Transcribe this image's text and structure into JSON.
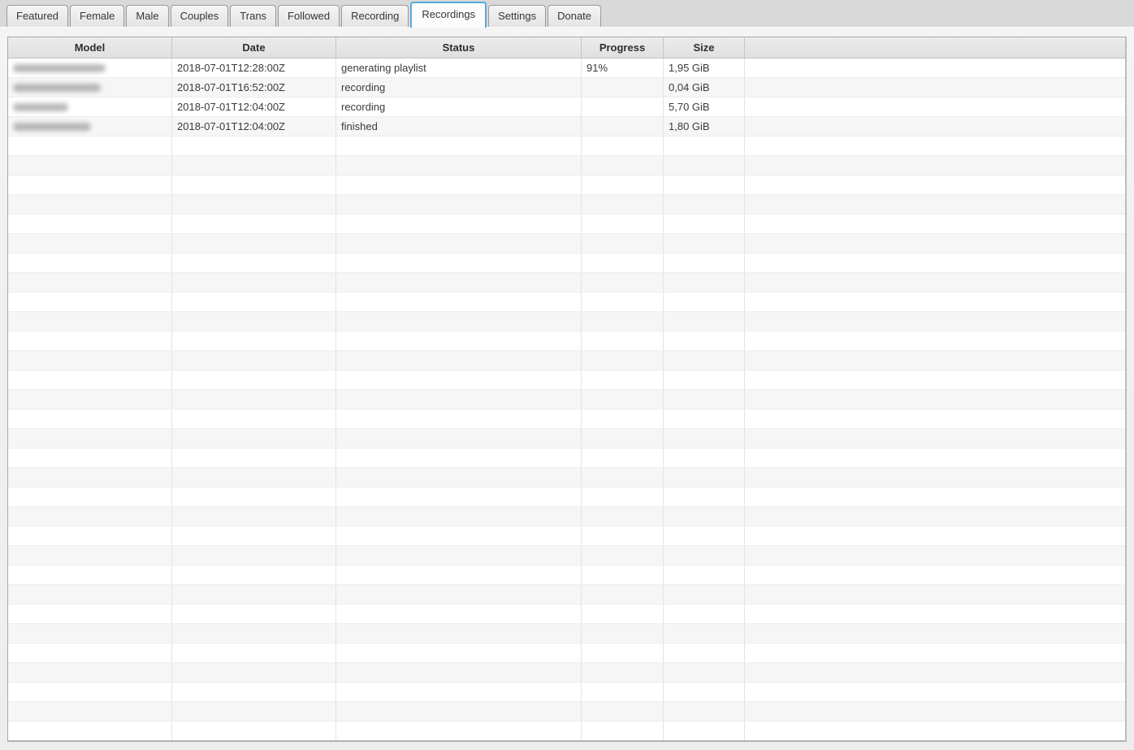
{
  "app": {
    "description": "recordings-manager-window"
  },
  "tabs": [
    {
      "label": "Featured",
      "active": false
    },
    {
      "label": "Female",
      "active": false
    },
    {
      "label": "Male",
      "active": false
    },
    {
      "label": "Couples",
      "active": false
    },
    {
      "label": "Trans",
      "active": false
    },
    {
      "label": "Followed",
      "active": false
    },
    {
      "label": "Recording",
      "active": false
    },
    {
      "label": "Recordings",
      "active": true
    },
    {
      "label": "Settings",
      "active": false
    },
    {
      "label": "Donate",
      "active": false
    }
  ],
  "table": {
    "columns": [
      {
        "key": "model",
        "label": "Model"
      },
      {
        "key": "date",
        "label": "Date"
      },
      {
        "key": "status",
        "label": "Status"
      },
      {
        "key": "progress",
        "label": "Progress"
      },
      {
        "key": "size",
        "label": "Size"
      },
      {
        "key": "fill",
        "label": ""
      }
    ],
    "rows": [
      {
        "model": "",
        "model_redacted": true,
        "model_blur_width": 114,
        "date": "2018-07-01T12:28:00Z",
        "status": "generating playlist",
        "progress": "91%",
        "size": "1,95 GiB",
        "fill": ""
      },
      {
        "model": "",
        "model_redacted": true,
        "model_blur_width": 108,
        "date": "2018-07-01T16:52:00Z",
        "status": "recording",
        "progress": "",
        "size": "0,04 GiB",
        "fill": ""
      },
      {
        "model": "",
        "model_redacted": true,
        "model_blur_width": 68,
        "date": "2018-07-01T12:04:00Z",
        "status": "recording",
        "progress": "",
        "size": "5,70 GiB",
        "fill": ""
      },
      {
        "model": "",
        "model_redacted": true,
        "model_blur_width": 96,
        "date": "2018-07-01T12:04:00Z",
        "status": "finished",
        "progress": "",
        "size": "1,80 GiB",
        "fill": ""
      }
    ],
    "empty_row_count": 31
  },
  "colors": {
    "accent_tab_border": "#58aadc",
    "tabbar_background": "#d9d9d9",
    "pane_background": "#efefef",
    "header_gradient_top": "#ececec",
    "header_gradient_bottom": "#e0e0e0",
    "row_stripe": "#f6f6f7",
    "grid_line_vertical": "#e3e3e3",
    "grid_line_horizontal": "#ededed",
    "table_border": "#a9a9a9",
    "text": "#3a3a3a"
  }
}
